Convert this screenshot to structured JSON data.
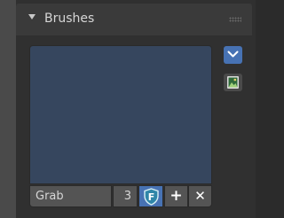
{
  "panel": {
    "title": "Brushes",
    "collapsed": false
  },
  "brush": {
    "name": "Grab",
    "user_count": "3",
    "fake_user_label": "F",
    "new_label": "+",
    "unlink_label": "✕"
  },
  "icons": {
    "collapse": "disclosure-triangle-down-icon",
    "grip": "drag-grip-icon",
    "dropdown": "chevron-down-icon",
    "image": "image-icon",
    "fake_user": "shield-fake-user-icon"
  },
  "colors": {
    "accent": "#4772b3",
    "preview": "#36465e",
    "panel": "#303030",
    "header": "#3a3a3a"
  }
}
